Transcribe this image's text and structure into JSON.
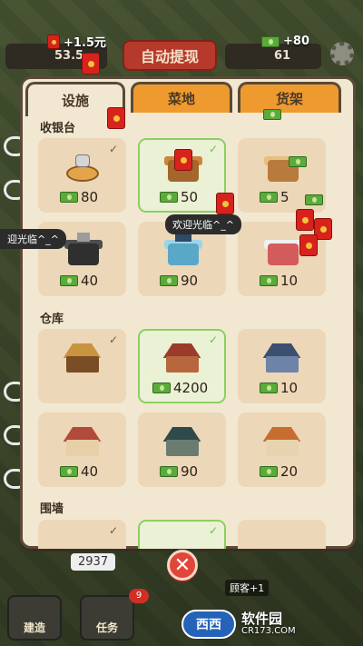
{
  "top": {
    "reward_text": "+1.5元",
    "cash_reward_text": "+80",
    "coin_left": "53.5",
    "coin_right": "61",
    "withdraw_label": "自动提现"
  },
  "tabs": [
    {
      "label": "设施",
      "active": true
    },
    {
      "label": "菜地",
      "active": false
    },
    {
      "label": "货架",
      "active": false
    }
  ],
  "sections": [
    {
      "title": "收银台",
      "items": [
        {
          "price": "80",
          "owned": true,
          "selected": false,
          "icon": "cash-register-icon"
        },
        {
          "price": "50",
          "owned": true,
          "selected": true,
          "icon": "desk-icon"
        },
        {
          "price": "5",
          "owned": false,
          "selected": false,
          "icon": "counter-icon"
        },
        {
          "price": "40",
          "owned": false,
          "selected": false,
          "icon": "register-icon"
        },
        {
          "price": "90",
          "owned": false,
          "selected": false,
          "icon": "laptop-counter-icon"
        },
        {
          "price": "10",
          "owned": false,
          "selected": false,
          "icon": "printer-counter-icon"
        }
      ]
    },
    {
      "title": "仓库",
      "items": [
        {
          "price": "",
          "owned": true,
          "selected": false,
          "icon": "warehouse-icon"
        },
        {
          "price": "4200",
          "owned": true,
          "selected": true,
          "icon": "warehouse-icon"
        },
        {
          "price": "10",
          "owned": false,
          "selected": false,
          "icon": "warehouse-icon"
        },
        {
          "price": "40",
          "owned": false,
          "selected": false,
          "icon": "warehouse-icon"
        },
        {
          "price": "90",
          "owned": false,
          "selected": false,
          "icon": "warehouse-icon"
        },
        {
          "price": "20",
          "owned": false,
          "selected": false,
          "icon": "warehouse-icon"
        }
      ]
    },
    {
      "title": "围墙"
    }
  ],
  "tooltips": {
    "center": "欢迎光临^_^",
    "left": "迎光临^_^"
  },
  "bottom": {
    "count": "2937",
    "build_label": "建造",
    "task_label": "任务",
    "task_badge": "9",
    "bonus_label": "顾客+1"
  },
  "watermark": {
    "logo": "西西",
    "name": "软件园",
    "site": "CR173.COM"
  },
  "colors": {
    "panel_bg": "#f2e8d2",
    "tab_active": "#f2e8d2",
    "tab_inactive": "#ef9a2e",
    "card_bg": "#ecd7b8",
    "card_selected_border": "#8ccf62",
    "close_button": "#e0463a"
  }
}
